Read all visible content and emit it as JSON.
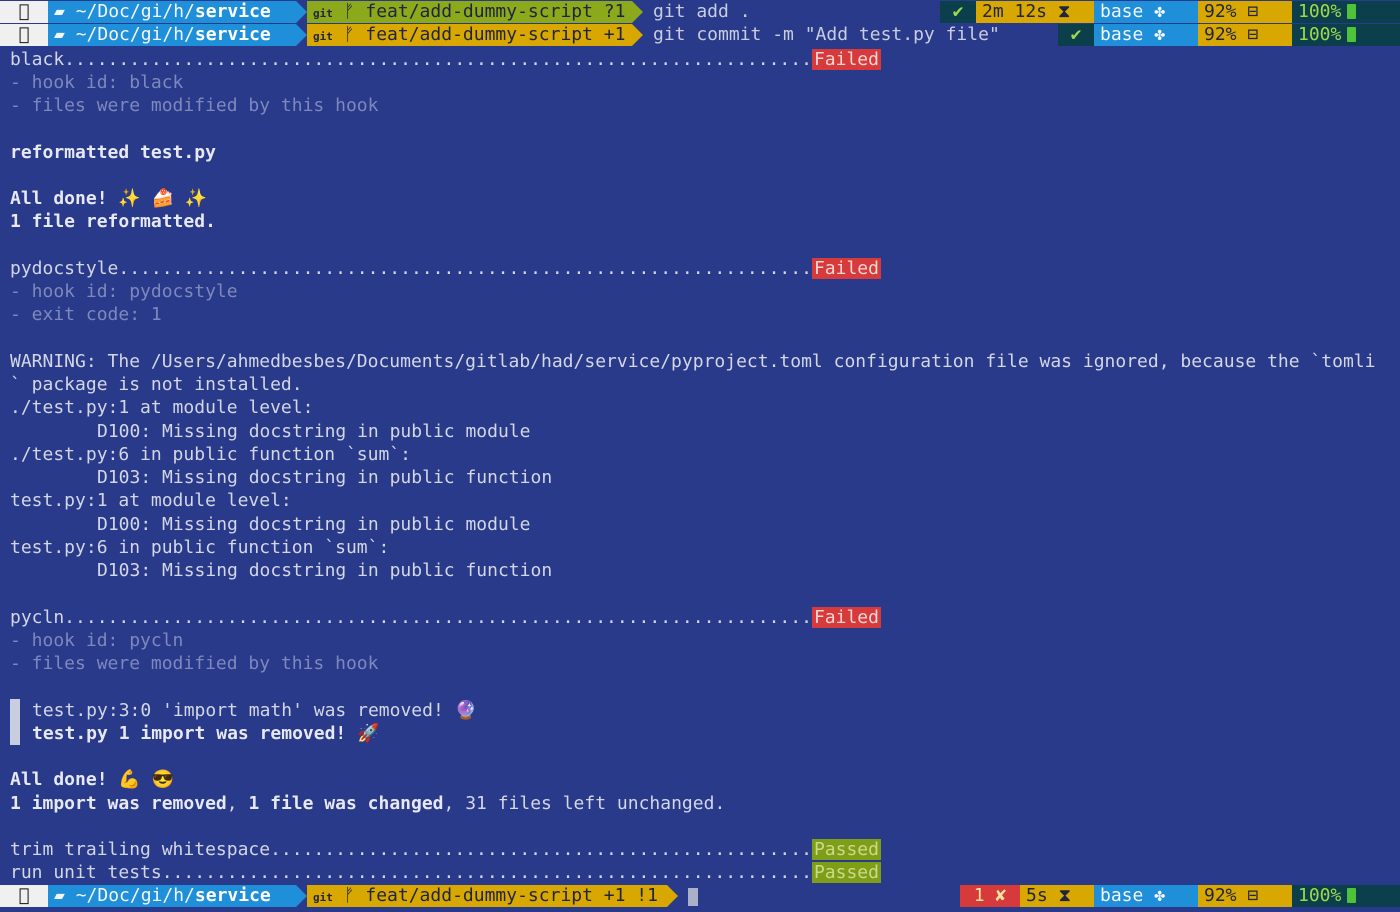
{
  "prompts": [
    {
      "apple_icon": "apple-icon",
      "path_prefix": "~/Doc/gi/h/",
      "path_dir": "service",
      "git_label": "git",
      "branch": "feat/add-dummy-script ?1",
      "command": "git add .",
      "status": "✔",
      "duration": "2m 12s",
      "env": "base",
      "ram": "92%",
      "battery": "100%"
    },
    {
      "apple_icon": "apple-icon",
      "path_prefix": "~/Doc/gi/h/",
      "path_dir": "service",
      "git_label": "git",
      "branch": "feat/add-dummy-script +1",
      "command": "git commit -m \"Add test.py file\"",
      "status": "✔",
      "env": "base",
      "ram": "92%",
      "battery": "100%"
    },
    {
      "apple_icon": "apple-icon",
      "path_prefix": "~/Doc/gi/h/",
      "path_dir": "service",
      "git_label": "git",
      "branch": "feat/add-dummy-script +1 !1",
      "status": "1 ✘",
      "duration": "5s",
      "env": "base",
      "ram": "92%",
      "battery": "100%"
    }
  ],
  "output": {
    "black_hook": "black.....................................................................",
    "failed": "Failed",
    "passed": "Passed",
    "black_id": "- hook id: black",
    "black_mod": "- files were modified by this hook",
    "reformatted": "reformatted test.py",
    "all_done_1": "All done! ✨ 🍰 ✨",
    "one_file": "1 file reformatted.",
    "pydoc_hook": "pydocstyle................................................................",
    "pydoc_id": "- hook id: pydocstyle",
    "pydoc_exit": "- exit code: 1",
    "warning_1": "WARNING: The /Users/ahmedbesbes/Documents/gitlab/had/service/pyproject.toml configuration file was ignored, because the `tomli",
    "warning_2": "` package is not installed.",
    "d_1": "./test.py:1 at module level:",
    "d_2": "D100: Missing docstring in public module",
    "d_3": "./test.py:6 in public function `sum`:",
    "d_4": "D103: Missing docstring in public function",
    "d_5": "test.py:1 at module level:",
    "d_6": "D100: Missing docstring in public module",
    "d_7": "test.py:6 in public function `sum`:",
    "d_8": "D103: Missing docstring in public function",
    "pycln_hook": "pycln.....................................................................",
    "pycln_id": "- hook id: pycln",
    "pycln_mod": "- files were modified by this hook",
    "removed_1": "test.py:3:0 'import math' was removed! 🔮",
    "removed_2": "test.py 1 import was removed! 🚀",
    "all_done_2": "All done! 💪 😎",
    "summary_bold_1": "1 import was removed",
    "summary_sep": ", ",
    "summary_bold_2": "1 file was changed",
    "summary_rest": ", 31 files left unchanged.",
    "trim_hook": "trim trailing whitespace..................................................",
    "unit_hook": "run unit tests............................................................"
  }
}
